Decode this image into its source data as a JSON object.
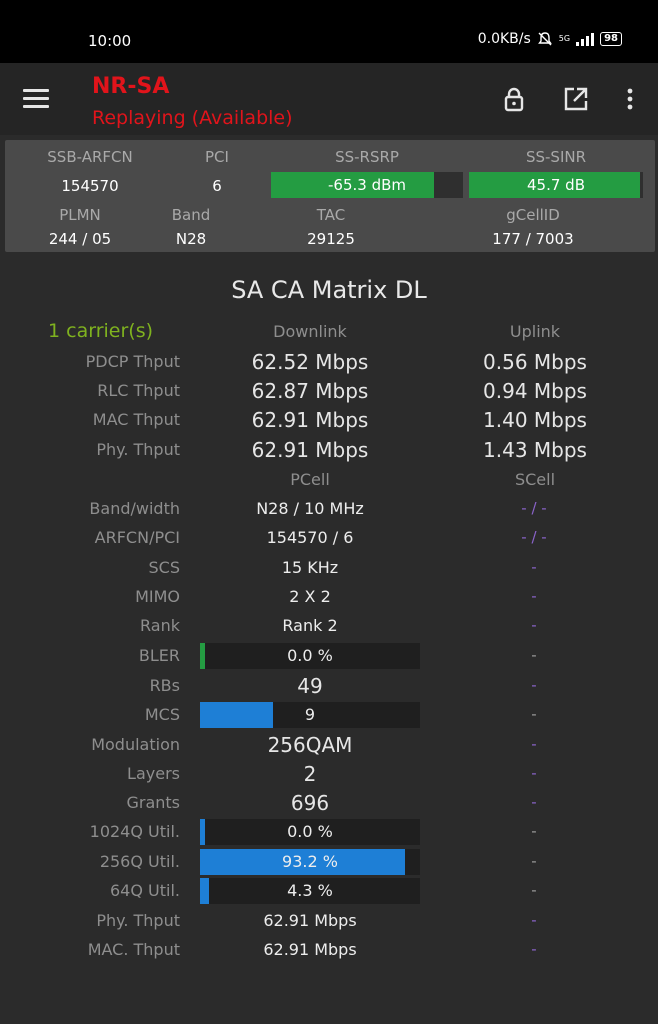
{
  "status_bar": {
    "time": "10:00",
    "speed": "0.0KB/s",
    "network": "5G",
    "battery": "98"
  },
  "app_bar": {
    "title": "NR-SA",
    "subtitle": "Replaying (Available)"
  },
  "cell_info": {
    "ssb_arfcn": {
      "label": "SSB-ARFCN",
      "value": "154570"
    },
    "pci": {
      "label": "PCI",
      "value": "6"
    },
    "ss_rsrp": {
      "label": "SS-RSRP",
      "value": "-65.3 dBm",
      "level": 0.85
    },
    "ss_sinr": {
      "label": "SS-SINR",
      "value": "45.7 dB",
      "level": 0.98
    },
    "plmn": {
      "label": "PLMN",
      "value": "244 / 05"
    },
    "band": {
      "label": "Band",
      "value": "N28"
    },
    "tac": {
      "label": "TAC",
      "value": "29125"
    },
    "gcellid": {
      "label": "gCellID",
      "value": "177 / 7003"
    }
  },
  "matrix": {
    "title": "SA CA Matrix DL",
    "carriers": "1 carrier(s)",
    "downlink_header": "Downlink",
    "uplink_header": "Uplink",
    "throughput": [
      {
        "label": "PDCP Thput",
        "dl": "62.52 Mbps",
        "ul": "0.56 Mbps"
      },
      {
        "label": "RLC Thput",
        "dl": "62.87 Mbps",
        "ul": "0.94 Mbps"
      },
      {
        "label": "MAC Thput",
        "dl": "62.91 Mbps",
        "ul": "1.40 Mbps"
      },
      {
        "label": "Phy. Thput",
        "dl": "62.91 Mbps",
        "ul": "1.43 Mbps"
      }
    ],
    "pcell_header": "PCell",
    "scell_header": "SCell",
    "rows": {
      "band_width": {
        "label": "Band/width",
        "pcell": "N28 / 10 MHz",
        "scell": "- / -"
      },
      "arfcn_pci": {
        "label": "ARFCN/PCI",
        "pcell": "154570 / 6",
        "scell": "- / -"
      },
      "scs": {
        "label": "SCS",
        "pcell": "15 KHz",
        "scell": "-"
      },
      "mimo": {
        "label": "MIMO",
        "pcell": "2 X 2",
        "scell": "-"
      },
      "rank": {
        "label": "Rank",
        "pcell": "Rank 2",
        "scell": "-"
      },
      "bler": {
        "label": "BLER",
        "pcell": "0.0 %",
        "scell": "-",
        "level": 0.0
      },
      "rbs": {
        "label": "RBs",
        "pcell": "49",
        "scell": "-"
      },
      "mcs": {
        "label": "MCS",
        "pcell": "9",
        "scell": "-",
        "level": 0.33
      },
      "modulation": {
        "label": "Modulation",
        "pcell": "256QAM",
        "scell": "-"
      },
      "layers": {
        "label": "Layers",
        "pcell": "2",
        "scell": "-"
      },
      "grants": {
        "label": "Grants",
        "pcell": "696",
        "scell": "-"
      },
      "q1024_util": {
        "label": "1024Q Util.",
        "pcell": "0.0 %",
        "scell": "-",
        "level": 0.0
      },
      "q256_util": {
        "label": "256Q Util.",
        "pcell": "93.2 %",
        "scell": "-",
        "level": 0.932
      },
      "q64_util": {
        "label": "64Q Util.",
        "pcell": "4.3 %",
        "scell": "-",
        "level": 0.043
      },
      "phy_thput": {
        "label": "Phy. Thput",
        "pcell": "62.91 Mbps",
        "scell": "-"
      },
      "mac_thput": {
        "label": "MAC. Thput",
        "pcell": "62.91 Mbps",
        "scell": "-"
      }
    }
  },
  "colors": {
    "accent_red": "#e1141b",
    "good_green": "#249c42",
    "bar_blue": "#1e7fd6",
    "carrier_green": "#7fb21f",
    "scell_purple": "#8a63c9"
  },
  "icons": [
    "menu-icon",
    "lock-icon",
    "open-external-icon",
    "more-vert-icon"
  ]
}
